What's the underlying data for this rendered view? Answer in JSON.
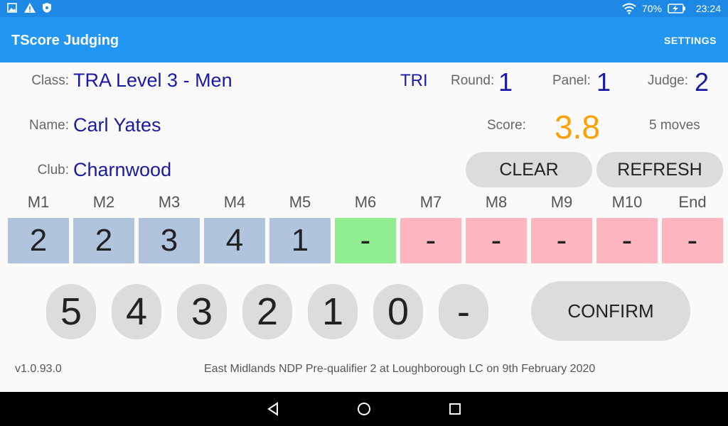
{
  "status_bar": {
    "battery": "70%",
    "time": "23:24"
  },
  "app_bar": {
    "title": "TScore Judging",
    "settings_label": "SETTINGS"
  },
  "info": {
    "class_label": "Class:",
    "class_value": "TRA Level 3 - Men",
    "discipline": "TRI",
    "round_label": "Round:",
    "round_value": "1",
    "panel_label": "Panel:",
    "panel_value": "1",
    "judge_label": "Judge:",
    "judge_value": "2",
    "name_label": "Name:",
    "name_value": "Carl Yates",
    "score_label": "Score:",
    "score_value": "3.8",
    "moves_text": "5 moves",
    "club_label": "Club:",
    "club_value": "Charnwood"
  },
  "buttons": {
    "clear": "CLEAR",
    "refresh": "REFRESH",
    "confirm": "CONFIRM"
  },
  "moves": [
    {
      "label": "M1",
      "value": "2",
      "state": "scored"
    },
    {
      "label": "M2",
      "value": "2",
      "state": "scored"
    },
    {
      "label": "M3",
      "value": "3",
      "state": "scored"
    },
    {
      "label": "M4",
      "value": "4",
      "state": "scored"
    },
    {
      "label": "M5",
      "value": "1",
      "state": "scored"
    },
    {
      "label": "M6",
      "value": "-",
      "state": "current"
    },
    {
      "label": "M7",
      "value": "-",
      "state": "empty"
    },
    {
      "label": "M8",
      "value": "-",
      "state": "empty"
    },
    {
      "label": "M9",
      "value": "-",
      "state": "empty"
    },
    {
      "label": "M10",
      "value": "-",
      "state": "empty"
    },
    {
      "label": "End",
      "value": "-",
      "state": "empty"
    }
  ],
  "keypad": [
    "5",
    "4",
    "3",
    "2",
    "1",
    "0",
    "-"
  ],
  "colors": {
    "accent": "#2196f3",
    "value_text": "#1a1aa6",
    "score": "#ffa000",
    "scored": "#b0c4de",
    "current": "#90ee90",
    "empty": "#ffb6c1"
  },
  "footer": {
    "version": "v1.0.93.0",
    "event": "East Midlands NDP Pre-qualifier 2 at Loughborough LC on 9th February 2020"
  }
}
